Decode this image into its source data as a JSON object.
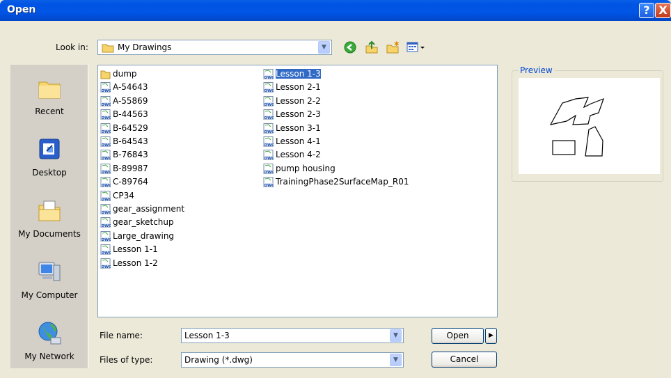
{
  "window": {
    "title": "Open"
  },
  "titlebar_buttons": {
    "help": "?",
    "close": "X"
  },
  "look_in": {
    "label": "Look in:",
    "value": "My Drawings"
  },
  "places": [
    {
      "label": "Recent",
      "icon": "folder-icon"
    },
    {
      "label": "Desktop",
      "icon": "desktop-icon"
    },
    {
      "label": "My Documents",
      "icon": "my-documents-icon"
    },
    {
      "label": "My Computer",
      "icon": "computer-icon"
    },
    {
      "label": "My Network",
      "icon": "network-icon"
    }
  ],
  "files_col1": [
    "dump",
    "A-54643",
    "A-55869",
    "B-44563",
    "B-64529",
    "B-64543",
    "B-76843",
    "B-89987",
    "C-89764",
    "CP34",
    "gear_assignment",
    "gear_sketchup",
    "Large_drawing",
    "Lesson 1-1",
    "Lesson 1-2"
  ],
  "files_col2": [
    "Lesson 1-3",
    "Lesson 2-1",
    "Lesson 2-2",
    "Lesson 2-3",
    "Lesson 3-1",
    "Lesson 4-1",
    "Lesson 4-2",
    "pump housing",
    "TrainingPhase2SurfaceMap_R01"
  ],
  "selected_file": "Lesson 1-3",
  "preview": {
    "label": "Preview"
  },
  "file_name": {
    "label": "File name:",
    "value": "Lesson 1-3"
  },
  "file_type": {
    "label": "Files of type:",
    "value": "Drawing (*.dwg)"
  },
  "buttons": {
    "open": "Open",
    "cancel": "Cancel"
  }
}
